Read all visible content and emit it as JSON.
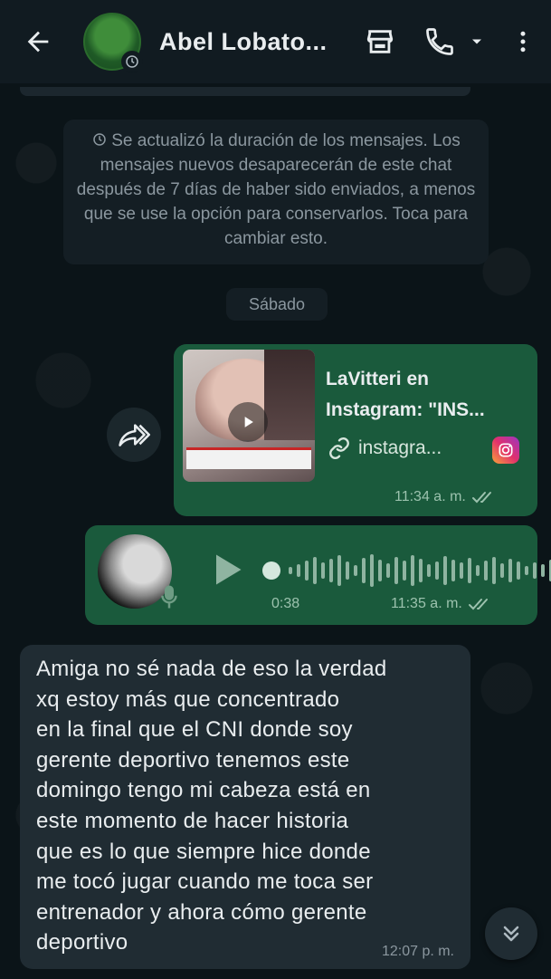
{
  "header": {
    "contact_name": "Abel Lobato...",
    "icons": [
      "back-arrow-icon",
      "timer-icon",
      "store-icon",
      "phone-icon",
      "chevron-down-icon",
      "more-vert-icon"
    ]
  },
  "system_note": {
    "text": "Se actualizó la duración de los mensajes. Los mensajes nuevos desaparecerán de este chat después de 7 días de haber sido enviados, a menos que se use la opción para conservarlos. Toca para cambiar esto."
  },
  "date_chip": "Sábado",
  "messages": [
    {
      "type": "link",
      "direction": "outgoing",
      "title": "LaVitteri en Instagram: \"INS...",
      "domain": "instagra...",
      "time": "11:34 a. m.",
      "status": "read-double-check"
    },
    {
      "type": "voice",
      "direction": "outgoing",
      "duration": "0:38",
      "time": "11:35 a. m.",
      "status": "read-double-check"
    },
    {
      "type": "text",
      "direction": "incoming",
      "text": "Amiga no sé nada de eso la verdad\nxq estoy más que concentrado\nen la final que el CNI donde soy\ngerente deportivo tenemos este\ndomingo tengo mi cabeza está en\neste momento de hacer historia\nque es lo que siempre hice donde\nme tocó jugar cuando me toca ser\nentrenador y ahora cómo gerente\ndeportivo",
      "time": "12:07 p. m."
    }
  ],
  "colors": {
    "header_bg": "#111b21",
    "outgoing_bubble": "#1a5a3c",
    "incoming_bubble": "#202c33",
    "read_tick": "#9cc2ae"
  }
}
